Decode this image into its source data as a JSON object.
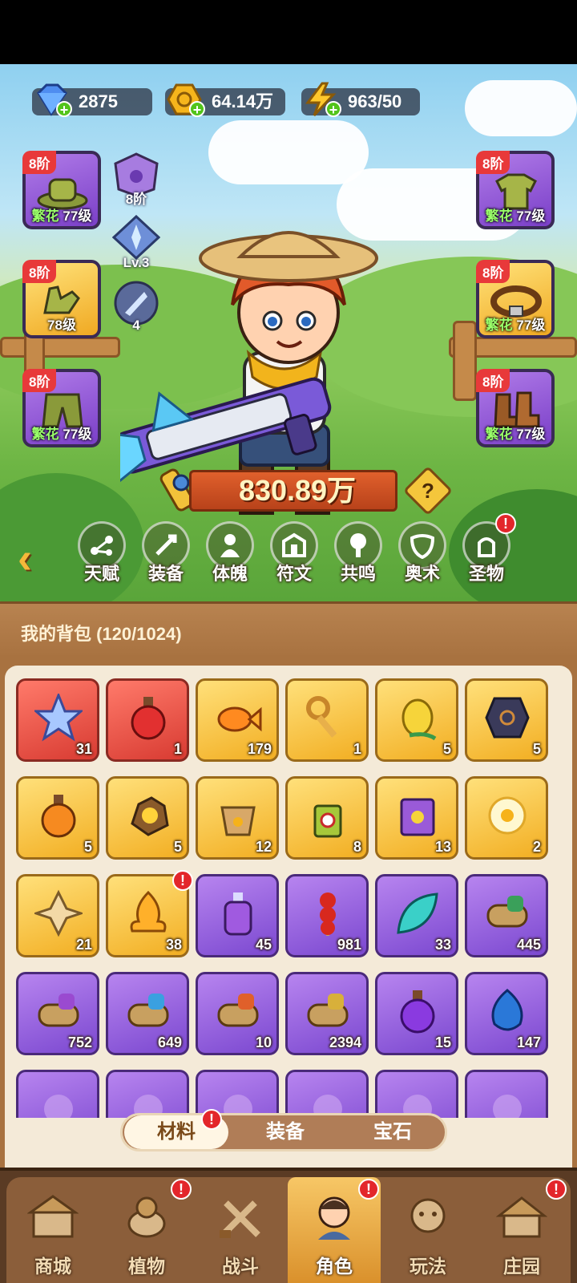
{
  "resources": {
    "diamond": {
      "value": "2875",
      "icon": "diamond-icon"
    },
    "gold": {
      "value": "64.14万",
      "icon": "gold-coin-icon"
    },
    "energy": {
      "value": "963/50",
      "icon": "lightning-icon"
    }
  },
  "equipment": {
    "left": [
      {
        "tier": "8阶",
        "tag": "繁花",
        "level": "77级",
        "item": "hat"
      },
      {
        "tier": "8阶",
        "tag": "",
        "level": "78级",
        "item": "gloves"
      },
      {
        "tier": "8阶",
        "tag": "繁花",
        "level": "77级",
        "item": "pants"
      }
    ],
    "right": [
      {
        "tier": "8阶",
        "tag": "繁花",
        "level": "77级",
        "item": "shirt"
      },
      {
        "tier": "8阶",
        "tag": "繁花",
        "level": "77级",
        "item": "belt"
      },
      {
        "tier": "8阶",
        "tag": "繁花",
        "level": "77级",
        "item": "boots"
      }
    ],
    "side_badges": [
      {
        "label": "8阶",
        "icon": "paw-crest-icon"
      },
      {
        "label": "Lv.3",
        "icon": "crystal-star-icon"
      },
      {
        "label": "4",
        "icon": "comet-icon"
      }
    ]
  },
  "power": "830.89万",
  "tabs": [
    {
      "label": "天赋",
      "icon": "talent-icon"
    },
    {
      "label": "装备",
      "icon": "equipment-icon"
    },
    {
      "label": "体魄",
      "icon": "physique-icon"
    },
    {
      "label": "符文",
      "icon": "rune-icon"
    },
    {
      "label": "共鸣",
      "icon": "resonance-tree-icon"
    },
    {
      "label": "奥术",
      "icon": "arcane-mask-icon"
    },
    {
      "label": "圣物",
      "icon": "relic-icon",
      "alert": "!"
    }
  ],
  "bag": {
    "title": "我的背包 (120/1024)",
    "items": [
      {
        "rarity": "red",
        "icon": "star-crystal-icon",
        "count": "31"
      },
      {
        "rarity": "red",
        "icon": "red-potion-icon",
        "count": "1"
      },
      {
        "rarity": "gold",
        "icon": "goldfish-icon",
        "count": "179"
      },
      {
        "rarity": "gold",
        "icon": "key-icon",
        "count": "1"
      },
      {
        "rarity": "gold",
        "icon": "seed-pod-icon",
        "count": "5"
      },
      {
        "rarity": "gold",
        "icon": "rune-stone-icon",
        "count": "5"
      },
      {
        "rarity": "gold",
        "icon": "orange-potion-icon",
        "count": "5"
      },
      {
        "rarity": "gold",
        "icon": "gold-ore-icon",
        "count": "5"
      },
      {
        "rarity": "gold",
        "icon": "flower-pot-icon",
        "count": "12"
      },
      {
        "rarity": "gold",
        "icon": "sprayer-icon",
        "count": "8"
      },
      {
        "rarity": "gold",
        "icon": "spell-book-icon",
        "count": "13"
      },
      {
        "rarity": "gold",
        "icon": "glow-flower-icon",
        "count": "2"
      },
      {
        "rarity": "gold",
        "icon": "knot-emblem-icon",
        "count": "21"
      },
      {
        "rarity": "gold",
        "icon": "flame-icon",
        "count": "38",
        "alert": "!"
      },
      {
        "rarity": "purple",
        "icon": "purple-potion-icon",
        "count": "45"
      },
      {
        "rarity": "purple",
        "icon": "candied-fruit-icon",
        "count": "981"
      },
      {
        "rarity": "purple",
        "icon": "teal-leaf-icon",
        "count": "33"
      },
      {
        "rarity": "purple",
        "icon": "green-scroll-icon",
        "count": "445"
      },
      {
        "rarity": "purple",
        "icon": "purple-scroll-icon",
        "count": "752"
      },
      {
        "rarity": "purple",
        "icon": "water-scroll-icon",
        "count": "649"
      },
      {
        "rarity": "purple",
        "icon": "fire-scroll-icon",
        "count": "10"
      },
      {
        "rarity": "purple",
        "icon": "lightning-scroll-icon",
        "count": "2394"
      },
      {
        "rarity": "purple",
        "icon": "violet-potion-icon",
        "count": "15"
      },
      {
        "rarity": "purple",
        "icon": "blue-bud-icon",
        "count": "147"
      },
      {
        "rarity": "purple",
        "icon": "partial-item-icon",
        "count": ""
      },
      {
        "rarity": "purple",
        "icon": "partial-item-icon",
        "count": ""
      },
      {
        "rarity": "purple",
        "icon": "partial-item-icon",
        "count": ""
      },
      {
        "rarity": "purple",
        "icon": "partial-item-icon",
        "count": ""
      },
      {
        "rarity": "purple",
        "icon": "partial-item-icon",
        "count": ""
      },
      {
        "rarity": "purple",
        "icon": "partial-item-icon",
        "count": ""
      }
    ]
  },
  "segment": {
    "options": [
      "材料",
      "装备",
      "宝石"
    ],
    "selected": "材料",
    "alert": "!"
  },
  "nav": [
    {
      "label": "商城",
      "icon": "shop-icon",
      "alert": ""
    },
    {
      "label": "植物",
      "icon": "plant-icon",
      "alert": "!"
    },
    {
      "label": "战斗",
      "icon": "battle-icon",
      "alert": ""
    },
    {
      "label": "角色",
      "icon": "character-icon",
      "alert": "!",
      "active": true
    },
    {
      "label": "玩法",
      "icon": "play-icon",
      "alert": ""
    },
    {
      "label": "庄园",
      "icon": "manor-icon",
      "alert": "!"
    }
  ],
  "colors": {
    "red": "#d83b32",
    "gold": "#f2ae22",
    "purple": "#7b48d0",
    "panel_brown": "#a87240",
    "alert": "#e3262b"
  }
}
